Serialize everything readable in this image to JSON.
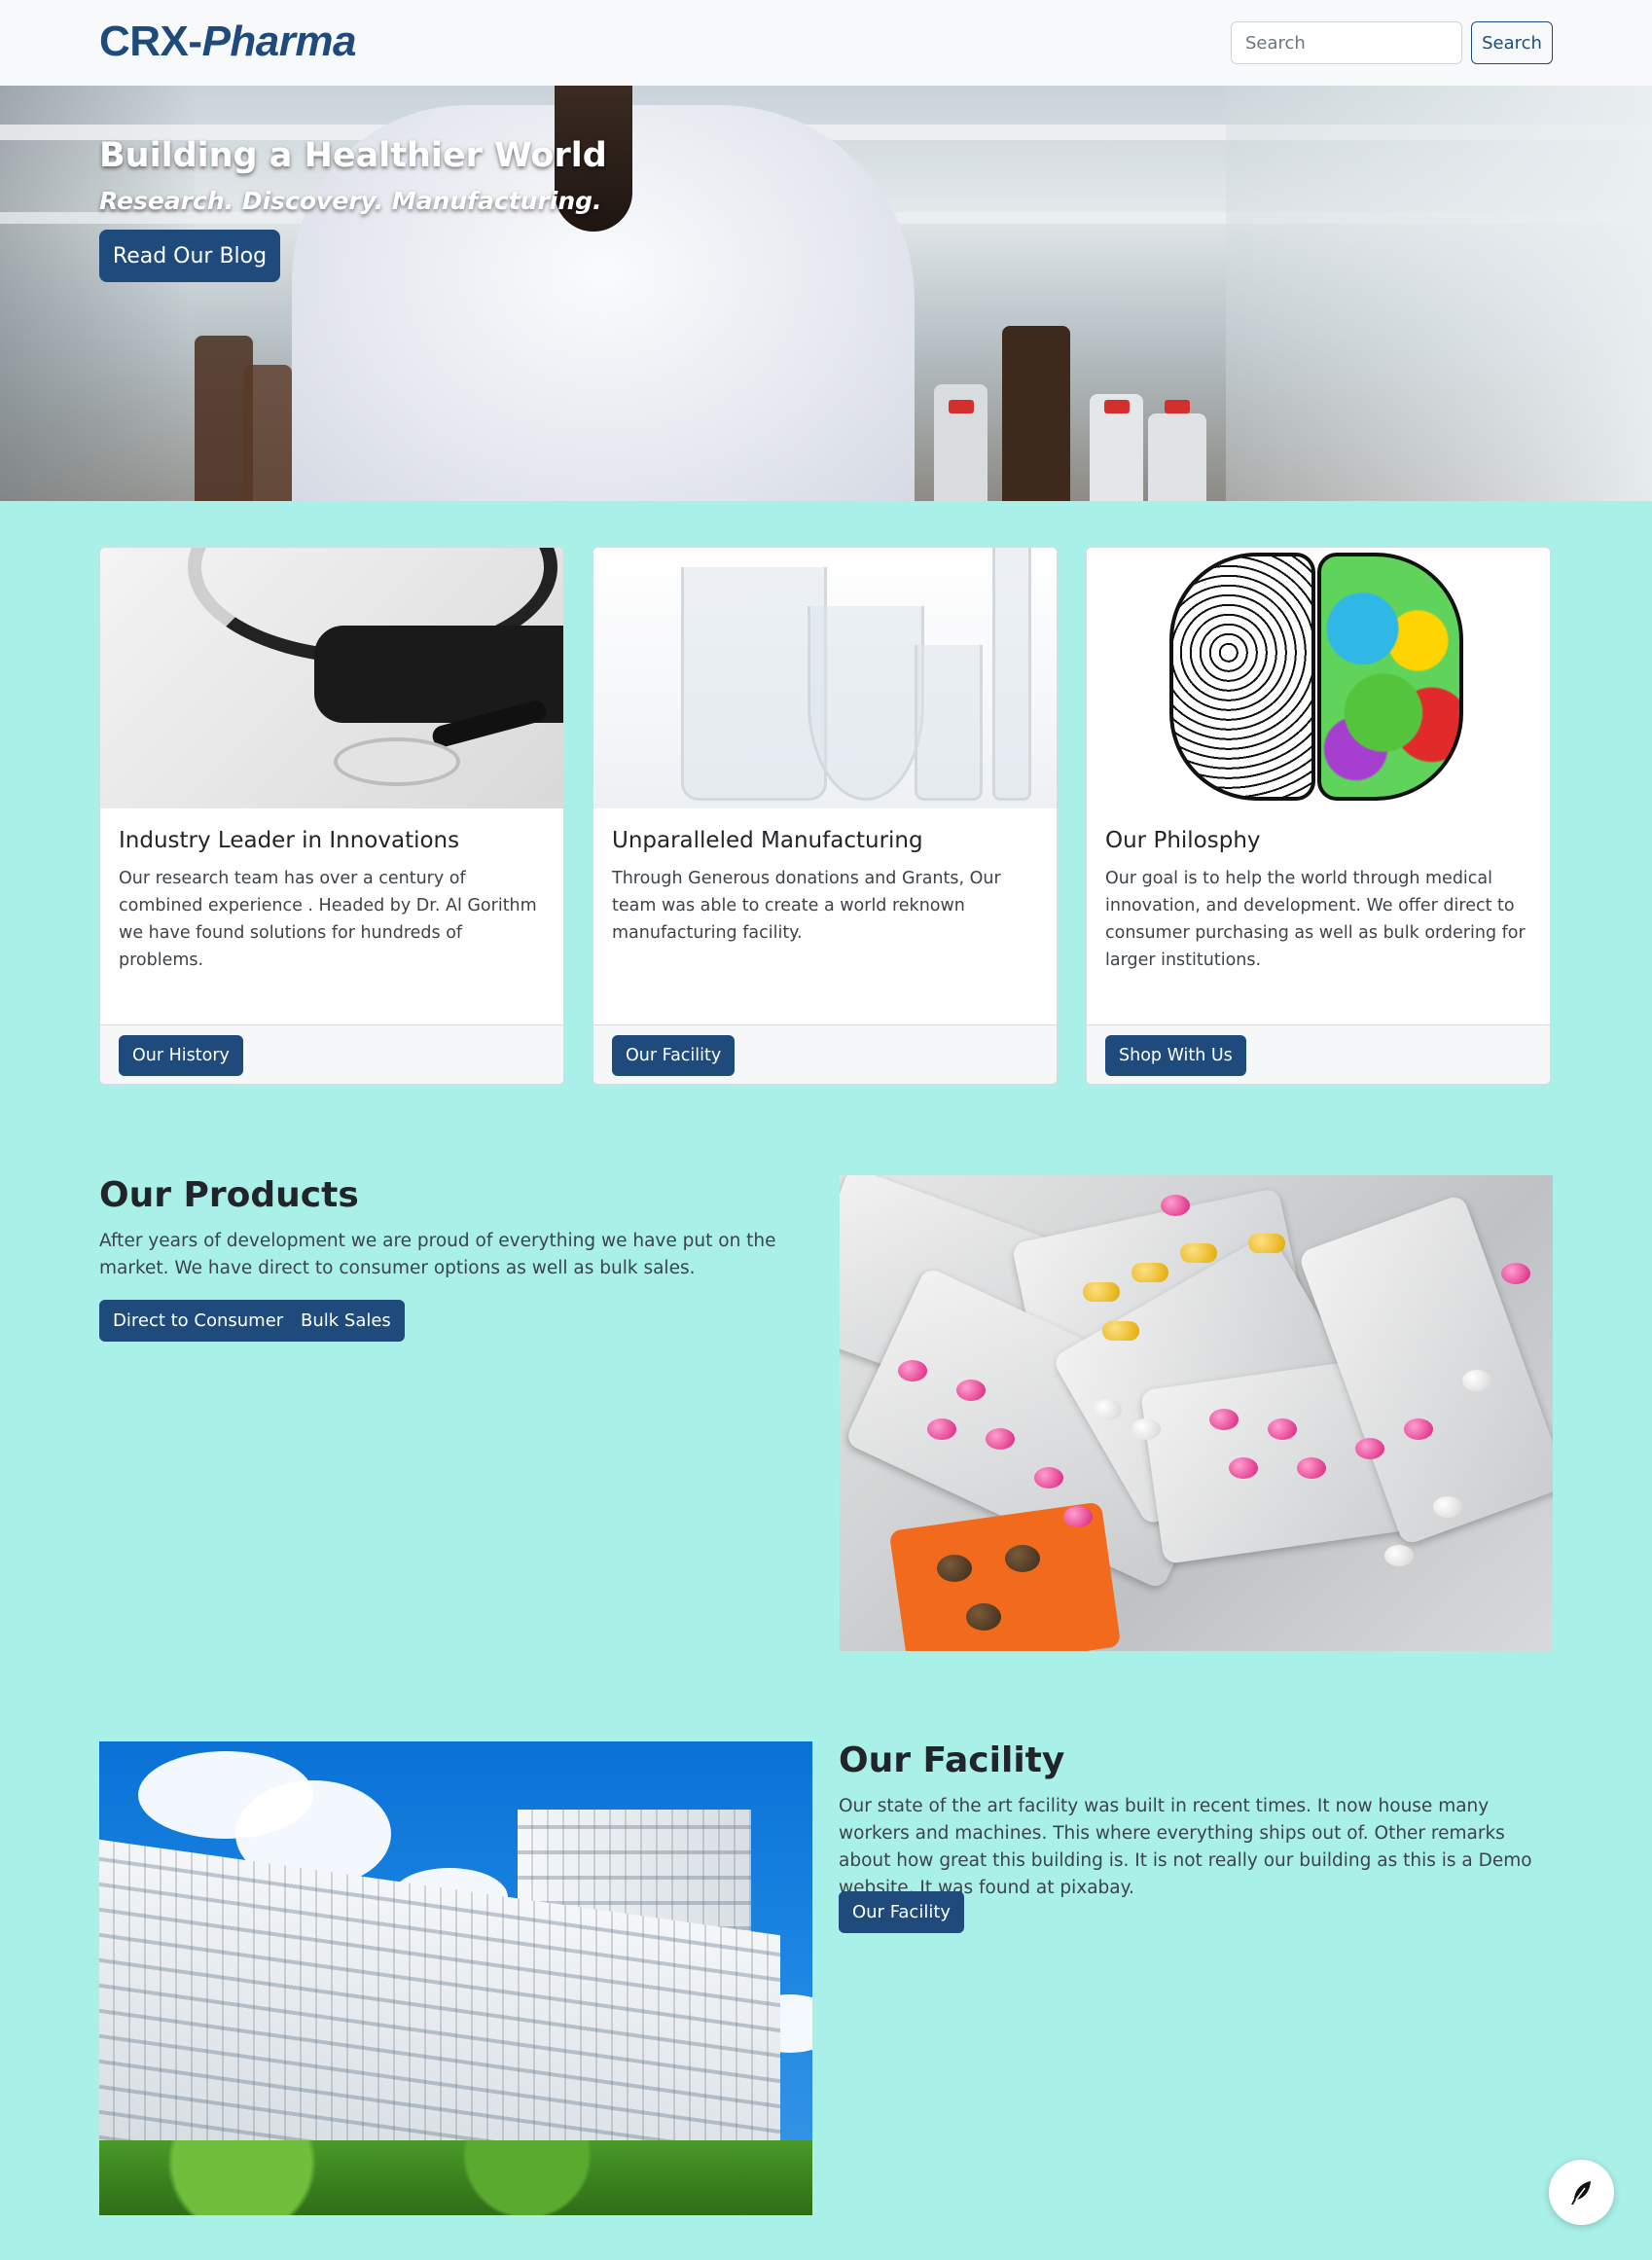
{
  "brand": {
    "part1": "CRX-",
    "part2": "Pharma",
    "color": "#1f4a7c"
  },
  "search": {
    "placeholder": "Search",
    "button_label": "Search"
  },
  "hero": {
    "title": "Building a Healthier World",
    "subtitle": "Research. Discovery. Manufacturing.",
    "button_label": "Read Our Blog"
  },
  "cards": [
    {
      "title": "Industry Leader in Innovations",
      "text": "Our research team has over a century of combined experience . Headed by Dr. Al Gorithm we have found solutions for hundreds of problems.",
      "button_label": "Our History",
      "image": "stethoscope-image"
    },
    {
      "title": "Unparalleled Manufacturing",
      "text": "Through Generous donations and Grants, Our team was able to create a world reknown manufacturing facility.",
      "button_label": "Our Facility",
      "image": "lab-glassware-image"
    },
    {
      "title": "Our Philosphy",
      "text": "Our goal is to help the world through medical innovation, and development. We offer direct to consumer purchasing as well as bulk ordering for larger institutions.",
      "button_label": "Shop With Us",
      "image": "brain-art-image"
    }
  ],
  "products": {
    "title": "Our Products",
    "text": "After years of development we are proud of everything we have put on the market. We have direct to consumer options as well as bulk sales.",
    "buttons": [
      "Direct to Consumer",
      "Bulk Sales"
    ],
    "image": "pill-blister-packs-image"
  },
  "facility": {
    "title": "Our Facility",
    "text": "Our state of the art facility was built in recent times. It now house many workers and machines. This where everything ships out of. Other remarks about how great this building is. It is not really our building as this is a Demo website. It was found at pixabay.",
    "button_label": "Our Facility",
    "image": "facility-building-image"
  },
  "fab": {
    "icon": "feather-icon"
  },
  "colors": {
    "background": "#a8f0e8",
    "primary": "#1f4a7c",
    "navbar": "#f8f9fa"
  }
}
